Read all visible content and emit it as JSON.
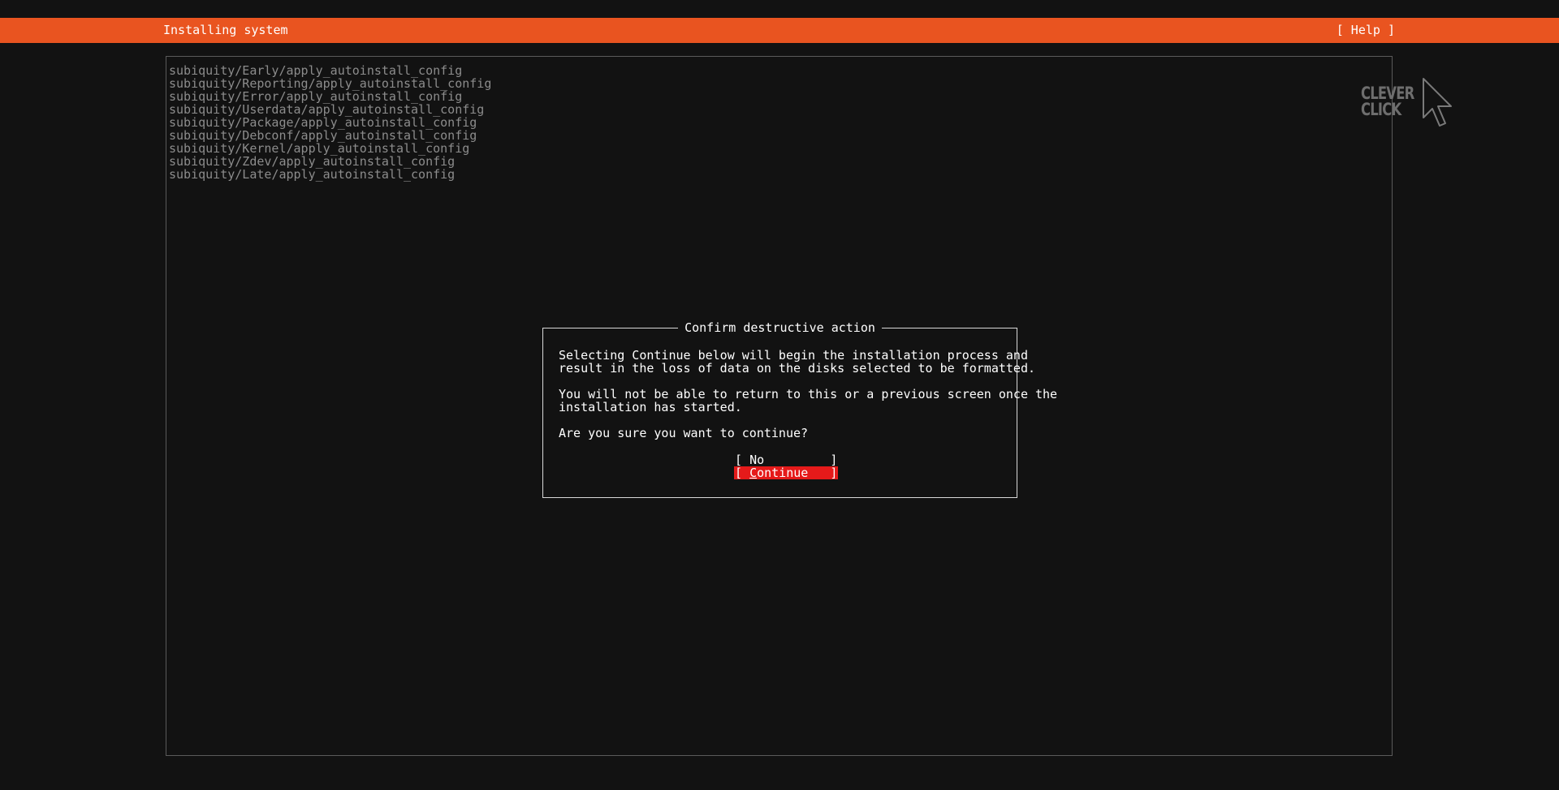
{
  "header": {
    "title": "Installing system",
    "help_label": "[ Help ]",
    "color": "#e95420"
  },
  "log": {
    "lines": [
      "subiquity/Early/apply_autoinstall_config",
      "subiquity/Reporting/apply_autoinstall_config",
      "subiquity/Error/apply_autoinstall_config",
      "subiquity/Userdata/apply_autoinstall_config",
      "subiquity/Package/apply_autoinstall_config",
      "subiquity/Debconf/apply_autoinstall_config",
      "subiquity/Kernel/apply_autoinstall_config",
      "subiquity/Zdev/apply_autoinstall_config",
      "subiquity/Late/apply_autoinstall_config"
    ]
  },
  "logo": {
    "line1": "CLEVER",
    "line2": "CLICK",
    "icon": "cursor-arrow-icon"
  },
  "dialog": {
    "title": "Confirm destructive action",
    "paragraph1": "Selecting Continue below will begin the installation process and\nresult in the loss of data on the disks selected to be formatted.",
    "paragraph2": "You will not be able to return to this or a previous screen once the\ninstallation has started.",
    "paragraph3": "Are you sure you want to continue?",
    "buttons": {
      "no": {
        "open": "[ ",
        "label": "No",
        "close": "         ]"
      },
      "continue": {
        "open": "[ ",
        "accel": "C",
        "label": "ontinue",
        "close": "   ]",
        "selected": true,
        "color": "#e51a1a"
      }
    }
  }
}
